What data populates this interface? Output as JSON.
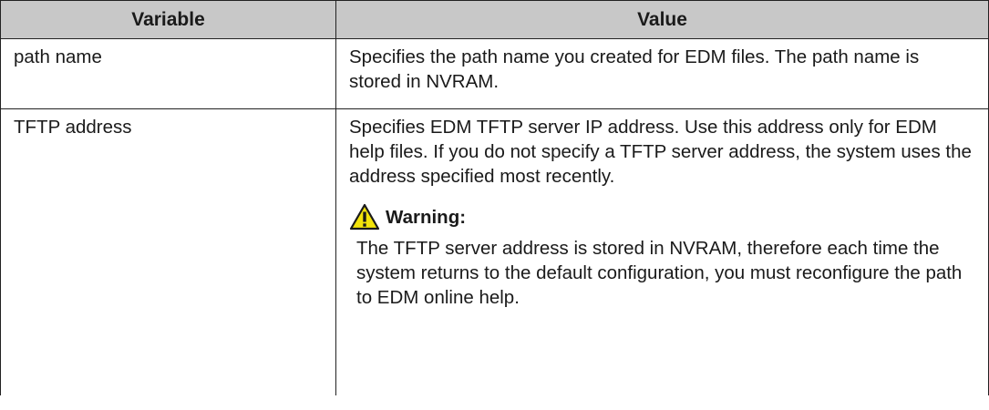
{
  "table": {
    "headers": {
      "variable": "Variable",
      "value": "Value"
    },
    "rows": [
      {
        "variable": "path name",
        "value": "Specifies the path name you created for EDM files. The path name is stored in NVRAM."
      },
      {
        "variable": "TFTP address",
        "value": "Specifies EDM TFTP server IP address. Use this address only for EDM help files. If you do not specify a TFTP server address, the system uses the address specified most recently.",
        "warning": {
          "icon": "warning-icon",
          "icon_color": "#f2e30a",
          "title": "Warning:",
          "text": "The TFTP server address is stored in NVRAM, therefore each time the system returns to the default configuration, you must reconfigure the path to EDM online help."
        }
      }
    ]
  },
  "colors": {
    "header_bg": "#c8c8c8",
    "border": "#222222"
  }
}
